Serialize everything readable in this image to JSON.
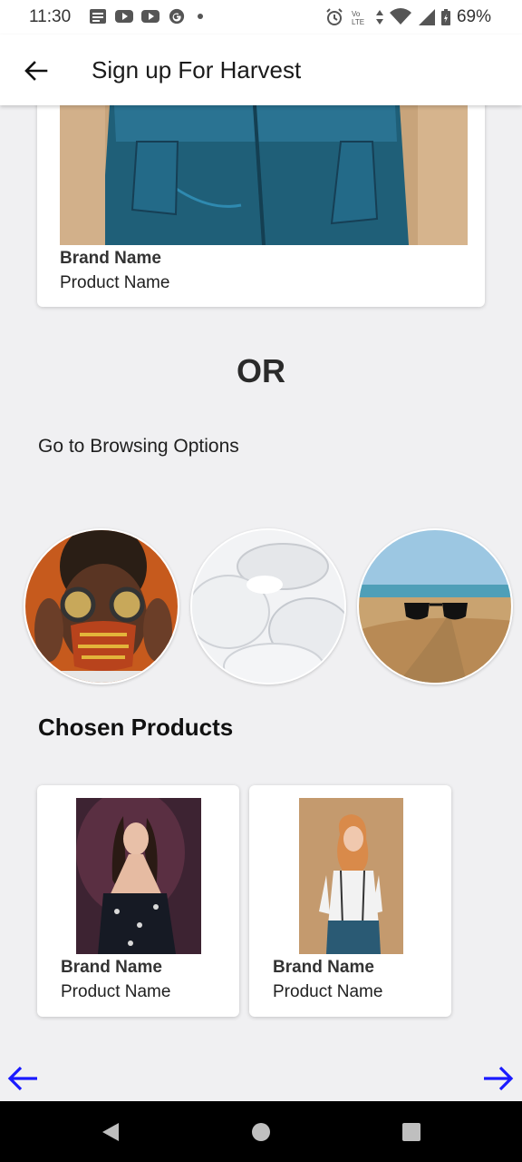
{
  "status_bar": {
    "time": "11:30",
    "battery": "69%",
    "network": "VoLTE",
    "left_icons": [
      "news-icon",
      "youtube-icon",
      "youtube-icon",
      "google-icon",
      "dot-icon"
    ],
    "right_icons": [
      "alarm-icon",
      "volte-icon",
      "data-arrows-icon",
      "wifi-icon",
      "signal-icon",
      "battery-icon"
    ]
  },
  "app_bar": {
    "title": "Sign up For Harvest",
    "back_icon": "arrow-left-icon"
  },
  "top_card": {
    "brand": "Brand Name",
    "product": "Product Name",
    "image": "denim-shorts-photo"
  },
  "or_text": "OR",
  "browse_label": "Go to Browsing Options",
  "browse_options": [
    {
      "image": "person-with-goggles-and-mask-photo"
    },
    {
      "image": "contact-lenses-photo"
    },
    {
      "image": "sunglasses-on-beach-photo"
    }
  ],
  "chosen_title": "Chosen Products",
  "chosen_products": [
    {
      "brand": "Brand Name",
      "product": "Product Name",
      "image": "woman-dark-dress-photo"
    },
    {
      "brand": "Brand Name",
      "product": "Product Name",
      "image": "woman-white-shirt-photo"
    }
  ],
  "pager": {
    "prev_icon": "arrow-left-icon",
    "next_icon": "arrow-right-icon",
    "color": "#1a1aff"
  },
  "system_nav": {
    "back": "nav-back-icon",
    "home": "nav-home-icon",
    "recents": "nav-recents-icon"
  }
}
